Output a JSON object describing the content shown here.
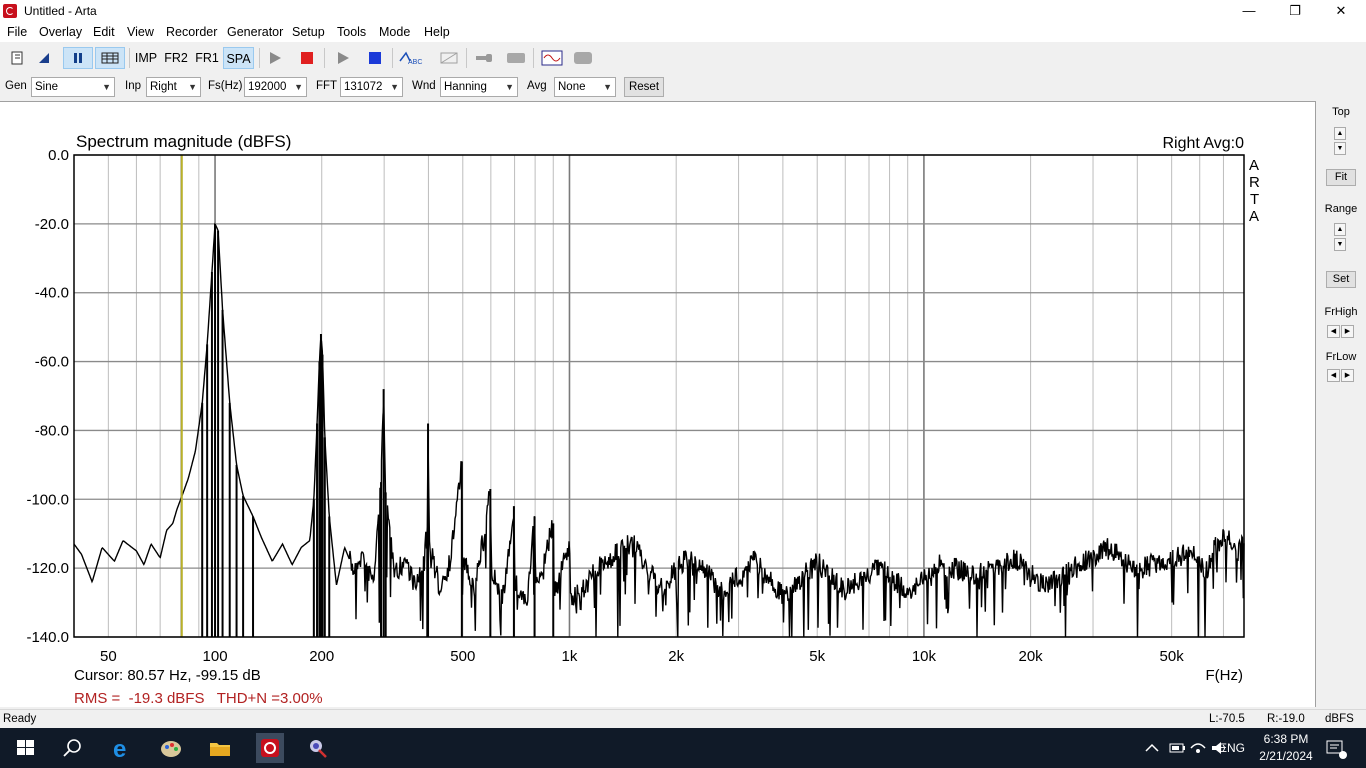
{
  "window": {
    "title": "Untitled - Arta",
    "controls": [
      "—",
      "❐",
      "✕"
    ]
  },
  "menu": [
    "File",
    "Overlay",
    "Edit",
    "View",
    "Recorder",
    "Generator",
    "Setup",
    "Tools",
    "Mode",
    "Help"
  ],
  "toolbar": {
    "imp": "IMP",
    "fr2": "FR2",
    "fr1": "FR1",
    "spa": "SPA",
    "abc": "ABC"
  },
  "controls": {
    "gen_label": "Gen",
    "gen_value": "Sine",
    "inp_label": "Inp",
    "inp_value": "Right",
    "fs_label": "Fs(Hz)",
    "fs_value": "192000",
    "fft_label": "FFT",
    "fft_value": "131072",
    "wnd_label": "Wnd",
    "wnd_value": "Hanning",
    "avg_label": "Avg",
    "avg_value": "None",
    "reset_label": "Reset"
  },
  "plot": {
    "title": "Spectrum magnitude (dBFS)",
    "channel_info": "Right  Avg:0",
    "brand_letters": [
      "A",
      "R",
      "T",
      "A"
    ],
    "cursor_text": "Cursor: 80.57 Hz, -99.15 dB",
    "measure_text": "RMS =  -19.3 dBFS   THD+N =3.00%",
    "x_axis_label": "F(Hz)",
    "cursor_color": "#b8b02a",
    "trace_color": "#000000",
    "measure_color": "#b22222"
  },
  "chart_data": {
    "type": "line",
    "title": "Spectrum magnitude (dBFS)",
    "xlabel": "F(Hz)",
    "ylabel": "",
    "x_scale": "log",
    "xlim": [
      40,
      80000
    ],
    "ylim": [
      -140,
      0
    ],
    "x_ticks": [
      {
        "v": 50,
        "label": "50"
      },
      {
        "v": 100,
        "label": "100"
      },
      {
        "v": 200,
        "label": "200"
      },
      {
        "v": 500,
        "label": "500"
      },
      {
        "v": 1000,
        "label": "1k"
      },
      {
        "v": 2000,
        "label": "2k"
      },
      {
        "v": 5000,
        "label": "5k"
      },
      {
        "v": 10000,
        "label": "10k"
      },
      {
        "v": 20000,
        "label": "20k"
      },
      {
        "v": 50000,
        "label": "50k"
      }
    ],
    "y_ticks": [
      0,
      -20,
      -40,
      -60,
      -80,
      -100,
      -120,
      -140
    ],
    "y_tick_labels": [
      "0.0",
      "-20.0",
      "-40.0",
      "-60.0",
      "-80.0",
      "-100.0",
      "-120.0",
      "-140.0"
    ],
    "cursor_x": 80.57,
    "grid": true,
    "series": [
      {
        "name": "Right",
        "points": [
          [
            40,
            -113
          ],
          [
            42,
            -116
          ],
          [
            45,
            -124
          ],
          [
            48,
            -114
          ],
          [
            52,
            -118
          ],
          [
            55,
            -112
          ],
          [
            60,
            -115
          ],
          [
            63,
            -119
          ],
          [
            66,
            -113
          ],
          [
            70,
            -117
          ],
          [
            73,
            -109
          ],
          [
            76,
            -107
          ],
          [
            78,
            -103
          ],
          [
            80.57,
            -99.15
          ],
          [
            84,
            -94
          ],
          [
            88,
            -86
          ],
          [
            92,
            -72
          ],
          [
            95,
            -55
          ],
          [
            98,
            -34
          ],
          [
            100,
            -20
          ],
          [
            102,
            -22
          ],
          [
            105,
            -45
          ],
          [
            110,
            -72
          ],
          [
            115,
            -90
          ],
          [
            120,
            -99
          ],
          [
            128,
            -105
          ],
          [
            135,
            -111
          ],
          [
            145,
            -118
          ],
          [
            155,
            -113
          ],
          [
            165,
            -119
          ],
          [
            175,
            -114
          ],
          [
            185,
            -112
          ],
          [
            190,
            -100
          ],
          [
            194,
            -78
          ],
          [
            197,
            -60
          ],
          [
            199,
            -52
          ],
          [
            201,
            -58
          ],
          [
            204,
            -82
          ],
          [
            210,
            -105
          ],
          [
            220,
            -125
          ],
          [
            232,
            -114
          ],
          [
            245,
            -120
          ],
          [
            260,
            -116
          ],
          [
            280,
            -124
          ],
          [
            294,
            -95
          ],
          [
            299,
            -68
          ],
          [
            303,
            -98
          ],
          [
            320,
            -122
          ],
          [
            345,
            -117
          ],
          [
            370,
            -126
          ],
          [
            397,
            -110
          ],
          [
            399,
            -78
          ],
          [
            402,
            -112
          ],
          [
            430,
            -125
          ],
          [
            460,
            -118
          ],
          [
            497,
            -89
          ],
          [
            502,
            -118
          ],
          [
            540,
            -126
          ],
          [
            598,
            -97
          ],
          [
            603,
            -121
          ],
          [
            650,
            -128
          ],
          [
            697,
            -102
          ],
          [
            702,
            -124
          ],
          [
            760,
            -130
          ],
          [
            797,
            -105
          ],
          [
            802,
            -126
          ],
          [
            900,
            -107
          ],
          [
            905,
            -128
          ],
          [
            1000,
            -112
          ],
          [
            1005,
            -130
          ],
          [
            1200,
            -120
          ],
          [
            1500,
            -112
          ],
          [
            1800,
            -126
          ],
          [
            2200,
            -115
          ],
          [
            2700,
            -127
          ],
          [
            3300,
            -117
          ],
          [
            4000,
            -128
          ],
          [
            5000,
            -118
          ],
          [
            6000,
            -126
          ],
          [
            7500,
            -119
          ],
          [
            9000,
            -127
          ],
          [
            11000,
            -118
          ],
          [
            14000,
            -122
          ],
          [
            18000,
            -117
          ],
          [
            22000,
            -125
          ],
          [
            28000,
            -118
          ],
          [
            33000,
            -114
          ],
          [
            40000,
            -120
          ],
          [
            50000,
            -117
          ],
          [
            57000,
            -115
          ],
          [
            63000,
            -121
          ],
          [
            66000,
            -112
          ],
          [
            72000,
            -111
          ],
          [
            76000,
            -114
          ],
          [
            80000,
            -112
          ]
        ]
      }
    ]
  },
  "side_panel": {
    "top": "Top",
    "fit": "Fit",
    "range": "Range",
    "set": "Set",
    "frhigh": "FrHigh",
    "frlow": "FrLow"
  },
  "status": {
    "ready": "Ready",
    "left_level": "L:-70.5",
    "right_level": "R:-19.0",
    "unit": "dBFS"
  },
  "taskbar": {
    "time": "6:38 PM",
    "date": "2/21/2024",
    "lang": "ENG"
  }
}
